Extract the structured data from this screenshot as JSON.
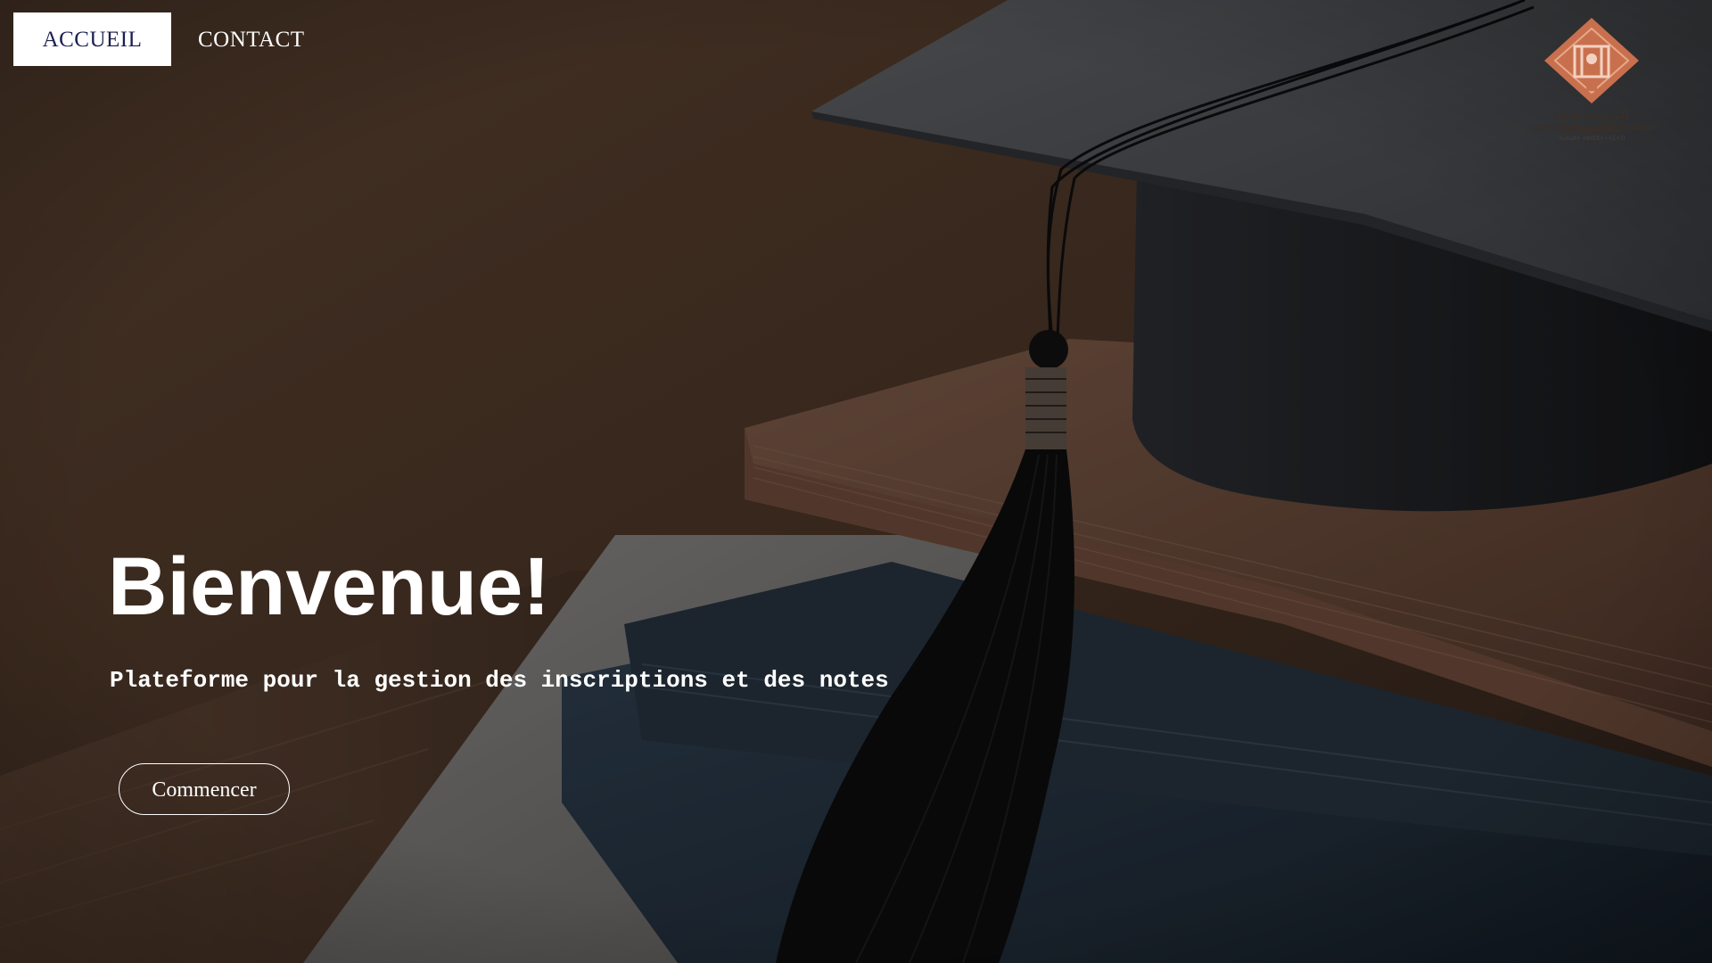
{
  "nav": {
    "items": [
      {
        "label": "ACCUEIL",
        "active": true
      },
      {
        "label": "CONTACT",
        "active": false
      }
    ]
  },
  "logo": {
    "arabic_text": "المدرسة العليا للتكنولوجيا",
    "french_text": "École Supérieure de Technologie",
    "sub_text": "ⵜⴰⵏⵏⴰⵍⵜ ⵜⵓⵏⵏⵉⴳⵜ ⵏ ⵜⵉⵜⵉⵏ"
  },
  "hero": {
    "title": "Bienvenue!",
    "subtitle": "Plateforme pour la gestion des inscriptions et des notes",
    "cta_label": "Commencer"
  },
  "colors": {
    "nav_active_bg": "#ffffff",
    "nav_active_text": "#1b2050",
    "hero_text": "#ffffff",
    "logo_accent": "#c8704e"
  }
}
